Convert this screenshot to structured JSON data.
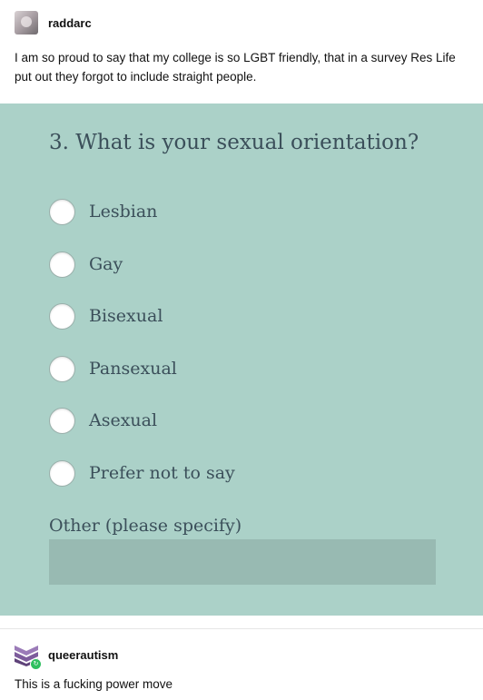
{
  "post": {
    "username": "raddarc",
    "text": "I am so proud to say that my college is so LGBT friendly, that in a survey Res Life put out they forgot to include straight people."
  },
  "survey": {
    "question": "3. What is your sexual orientation?",
    "options": [
      "Lesbian",
      "Gay",
      "Bisexual",
      "Pansexual",
      "Asexual",
      "Prefer not to say"
    ],
    "other_label": "Other (please specify)",
    "other_value": ""
  },
  "reblog": {
    "username": "queerautism",
    "text": "This is a fucking power move"
  },
  "colors": {
    "survey_bg": "#abd1c8",
    "field_bg": "#98bab2",
    "survey_text": "#3b4f5a",
    "reblog_badge": "#2fbf5f"
  },
  "icons": {
    "post_avatar": "avatar",
    "reblog_avatar": "chevron-stack-icon",
    "reblog_badge": "reblog-icon"
  }
}
